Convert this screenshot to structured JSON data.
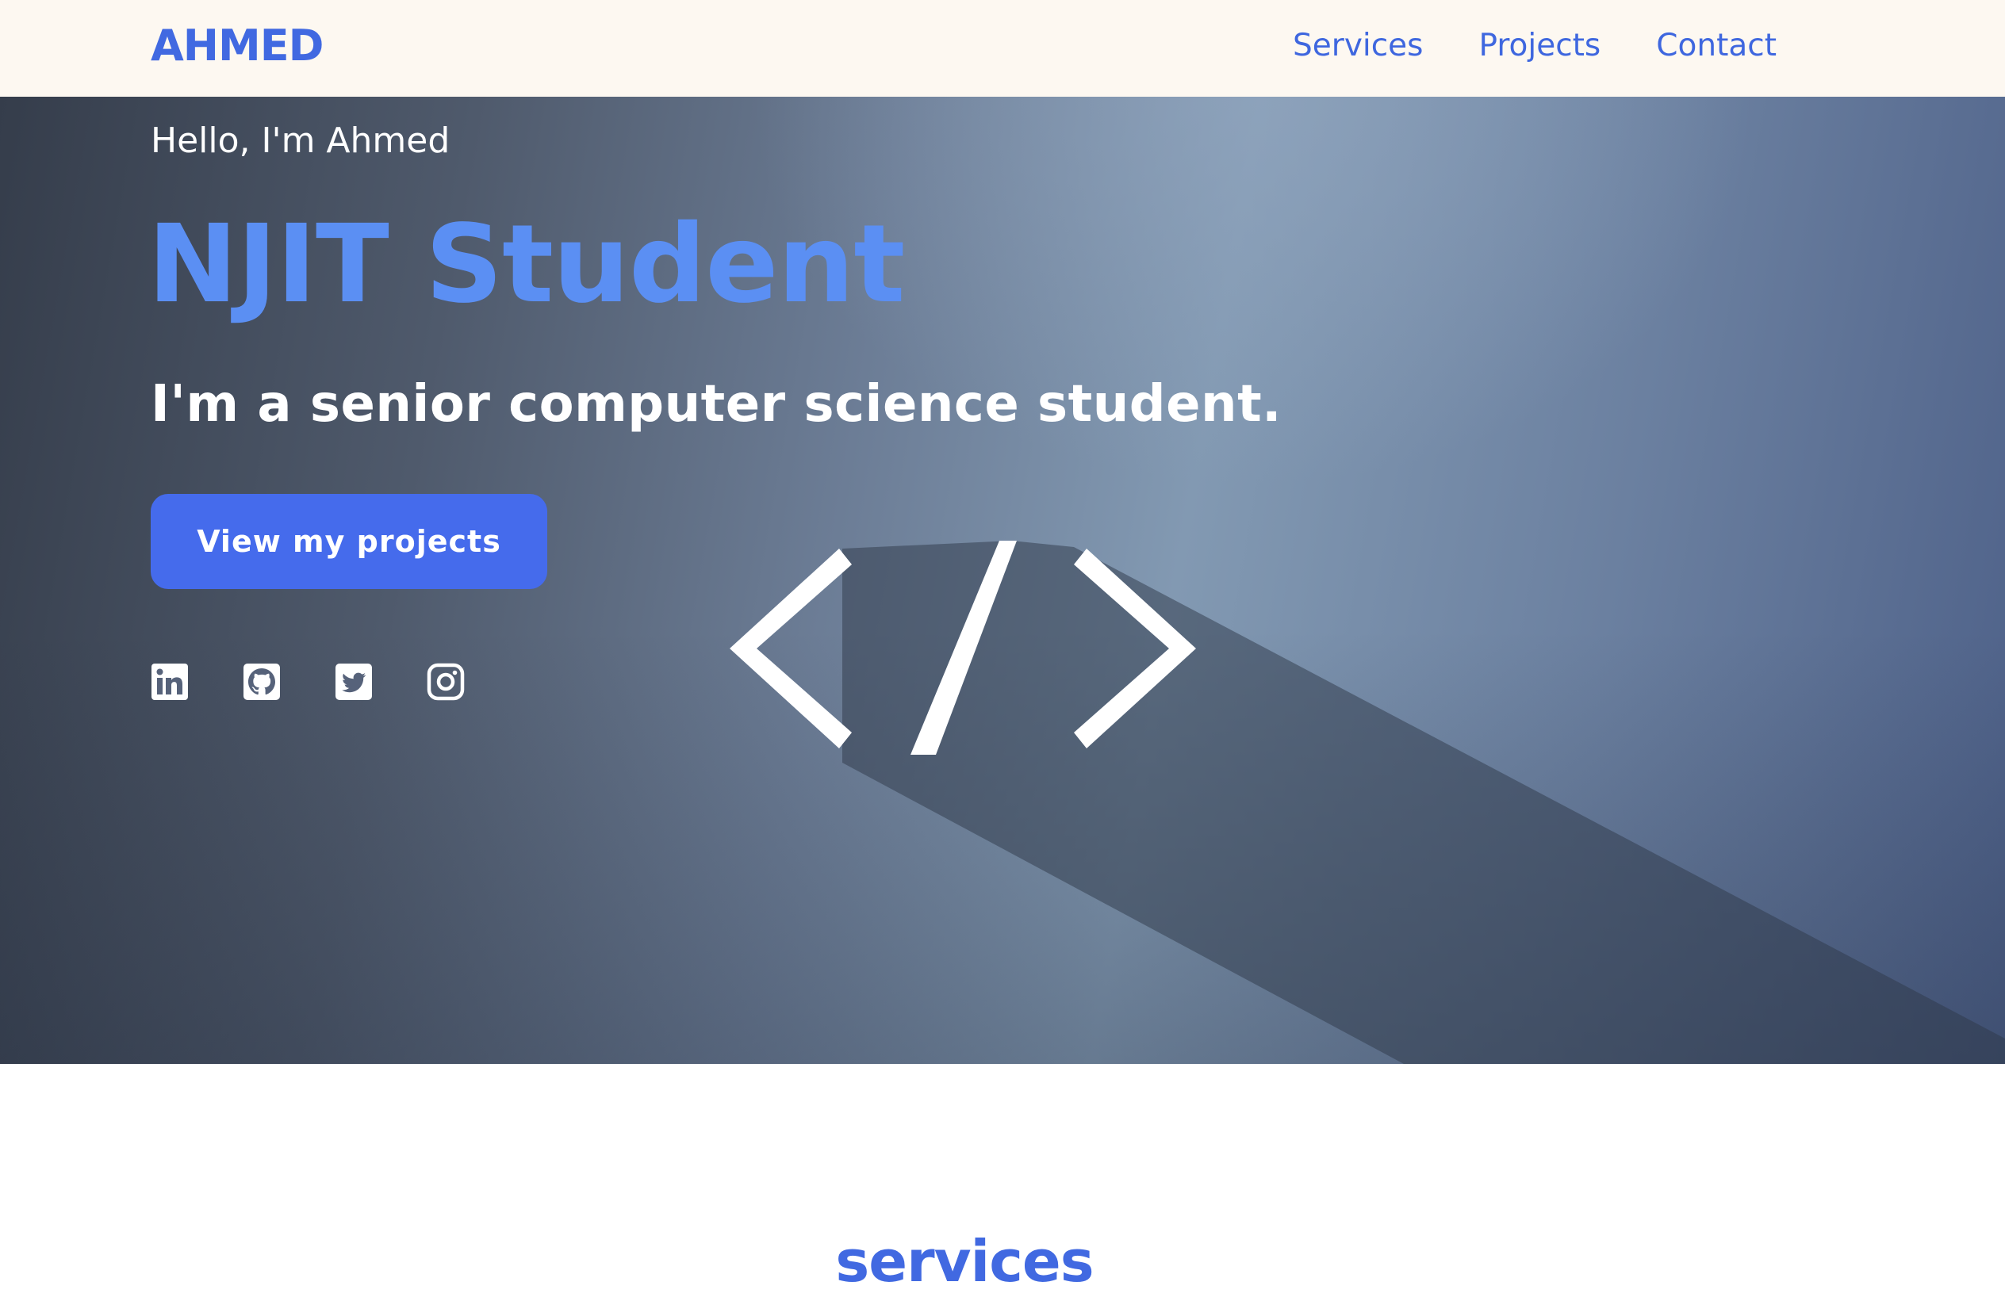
{
  "header": {
    "brand": "AHMED",
    "nav": [
      {
        "label": "Services"
      },
      {
        "label": "Projects"
      },
      {
        "label": "Contact"
      }
    ]
  },
  "hero": {
    "greeting": "Hello, I'm Ahmed",
    "role": "NJIT Student",
    "tagline": "I'm a senior computer science student.",
    "cta_label": "View my projects",
    "social_icons": [
      "linkedin-icon",
      "github-icon",
      "twitter-icon",
      "instagram-icon"
    ],
    "decorative_icon": "code-brackets-icon"
  },
  "services": {
    "title": "services"
  },
  "colors": {
    "accent": "#4169e1",
    "role_text": "#5b8ff3",
    "header_bg": "#fdf8f1",
    "button_bg": "#456bec"
  }
}
